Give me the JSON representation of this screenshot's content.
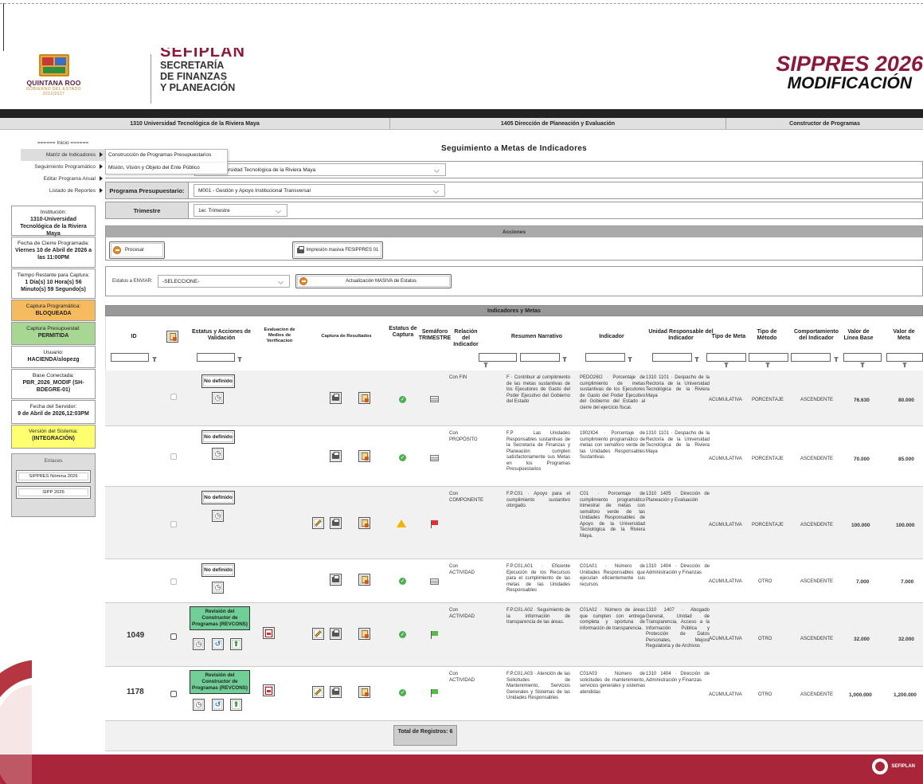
{
  "header": {
    "state_name": "QUINTANA ROO",
    "state_sub": "GOBIERNO DEL ESTADO 2022|2027",
    "sefiplan_big": "SEFIPLAN",
    "sefiplan_l1": "SECRETARÍA",
    "sefiplan_l2": "DE FINANZAS",
    "sefiplan_l3": "Y PLANEACIÓN",
    "app_title": "SIPPRES 2026",
    "app_subtitle": "MODIFICACIÓN"
  },
  "crumbs": [
    "1310 Universidad Tecnológica de la Riviera Maya",
    "1405 Dirección de Planeación y Evaluación",
    "Constructor de Programas"
  ],
  "menu": {
    "start": "====== Inicio ======",
    "items": [
      "Matriz de Indicadores",
      "Seguimiento Programático",
      "Editar Programa Anual",
      "Listado de Reportes"
    ],
    "submenu": [
      "Construcción de Programas Presupuestarios",
      "Misión, Visión y Objeto del Ente Público"
    ]
  },
  "sidebar": {
    "institucion_label": "Institución:",
    "institucion_value": "1310-Universidad Tecnológica de la Riviera Maya",
    "cierre_label": "Fecha de Cierre Programada:",
    "cierre_value": "Viernes 10 de Abril de 2026 a las 11:00PM",
    "tiempo_label": "Tiempo Restante para Captura:",
    "tiempo_value": "1 Día(s) 10 Hora(s) 56 Minuto(s) 59 Segundo(s)",
    "prog_label": "Captura Programática:",
    "prog_value": "BLOQUEADA",
    "pres_label": "Captura Presupuestal:",
    "pres_value": "PERMITIDA",
    "user_label": "Usuario:",
    "user_value": "HACIENDA\\slopezg",
    "db_label": "Base Conectada:",
    "db_value": "PBR_2026_MODIF (SH-BDEGRE-01)",
    "server_label": "Fecha del Servidor:",
    "server_value": "9 de Abril de 2026,12:03PM",
    "version_label": "Versión del Sistema:",
    "version_value": "(INTEGRACIÓN)",
    "links_title": "Enlaces",
    "link1": "SIPPRES Nómina 2026",
    "link2": "SIPP 2026"
  },
  "main": {
    "title": "Seguimiento a Metas de Indicadores",
    "inst_select": "1310 - Universidad Tecnológica de la Riviera Maya",
    "programa_label": "Programa Presupuestario:",
    "programa_value": "M001 - Gestión y Apoyo Institucional Transversal",
    "trimestre_label": "Trimestre",
    "trimestre_value": "1er. Trimestre",
    "acciones": "Acciones",
    "procesar": "Procesar",
    "impresion": "Impresión masiva FESIPPRES 01",
    "estatus_label": "Estatus a ENVIAR:",
    "estatus_value": "-SELECCIONE-",
    "actualizacion": "Actualización MASIVA de Estatus",
    "tabla_titulo": "Indicadores y Metas"
  },
  "columns": {
    "id": "ID",
    "estatus": "Estatus y Acciones de Validación",
    "evaluacion": "Evaluacion de Medios de Verificacion",
    "captura": "Captura de Resultados",
    "estatus_captura": "Estatus de Captura",
    "semaforo": "Semáforo TRIMESTRE",
    "relacion": "Relación del Indicador",
    "resumen": "Resumen Narrativo",
    "indicador": "Indicador",
    "unidad": "Unidad Responsable del Indicador",
    "tipo_meta": "Tipo de Meta",
    "tipo_metodo": "Tipo de Método",
    "comportamiento": "Comportamiento del Indicador",
    "linea_base": "Valor de Línea Base",
    "meta": "Valor de Meta"
  },
  "rows": [
    {
      "id": "",
      "status": "No definido",
      "relacion": "Con FIN",
      "resumen": "F · Contribuir al cumplimiento de las metas sustantivas de los Ejecutores de Gasto del Poder Ejecutivo del Gobierno del Estado",
      "indicador": "PEDO26I2 · Porcentaje de cumplimiento de metas sustantivas de los Ejecutores de Gasto del Poder Ejecutivo del Gobierno del Estado al cierre del ejercicio fiscal.",
      "unidad": "1310 1101 · Despacho de la Rectoría de la Universidad Tecnológica de la Riviera Maya",
      "tipo_meta": "ACUMULATIVA",
      "metodo": "PORCENTAJE",
      "comportamiento": "ASCENDENTE",
      "base": "76.630",
      "meta": "80.000"
    },
    {
      "id": "",
      "status": "No definido",
      "relacion": "Con PROPÓSITO",
      "resumen": "F.P · Las Unidades Responsables sustantivas de la Secretaría de Finanzas y Planeación cumplen satisfactoriamente sus Metas en los Programas Presupuestarios",
      "indicador": "1902IO4 · Porcentaje de cumplimiento programático de metas con semáforo verde de las Unidades Responsables Sustantivas",
      "unidad": "1310 1101 · Despacho de la Rectoría de la Universidad Tecnológica de la Riviera Maya",
      "tipo_meta": "ACUMULATIVA",
      "metodo": "PORCENTAJE",
      "comportamiento": "ASCENDENTE",
      "base": "70.000",
      "meta": "85.000"
    },
    {
      "id": "",
      "status": "No definido",
      "relacion": "Con COMPONENTE",
      "resumen": "F.P.C01 · Apoyo para el cumplimiento sustantivo otorgado.",
      "indicador": "C01 · Porcentaje de cumplimiento programático trimestral de metas con semáforo verde de las Unidades Responsables de Apoyo de la Universidad Tecnológica de la Riviera Maya.",
      "unidad": "1310 1405 · Dirección de Planeación y Evaluación",
      "tipo_meta": "ACUMULATIVA",
      "metodo": "PORCENTAJE",
      "comportamiento": "ASCENDENTE",
      "base": "100.000",
      "meta": "100.000"
    },
    {
      "id": "",
      "status": "No definido",
      "relacion": "Con ACTIVIDAD",
      "resumen": "F.P.C01.A01 · Eficiente Ejecución de los Recursos para el cumplimiento de las metas de las Unidades Responsables",
      "indicador": "C01A01 · Número de Unidades Responsables que ejecutan eficientemente sus recursos",
      "unidad": "1310 1404 · Dirección de Administración y Finanzas",
      "tipo_meta": "ACUMULATIVA",
      "metodo": "OTRO",
      "comportamiento": "ASCENDENTE",
      "base": "7.000",
      "meta": "7.000"
    },
    {
      "id": "1049",
      "status": "Revisión del Constructor de Programas (REVCONS)",
      "relacion": "Con ACTIVIDAD",
      "resumen": "F.P.C01.A02 · Seguimiento de la información de transparencia de las áreas.",
      "indicador": "C01A02 · Número de áreas que cumplen con entrega completa y oportuna de información de transparencia.",
      "unidad": "1310 1407 · Abogado General, Unidad de Transparencia, Acceso a la Información Pública y Protección de Datos Personales, Mejora Regulatoria y de Archivos",
      "tipo_meta": "ACUMULATIVA",
      "metodo": "OTRO",
      "comportamiento": "ASCENDENTE",
      "base": "32.000",
      "meta": "32.000"
    },
    {
      "id": "1178",
      "status": "Revisión del Constructor de Programas (REVCONS)",
      "relacion": "Con ACTIVIDAD",
      "resumen": "F.P.C01.A03 · Atención de las Solicitudes de Mantenimiento, Servicios Generales y Sistemas de las Unidades Responsables",
      "indicador": "C01A03 · Número de solicitudes de mantenimiento, servicios generales y sistemas atendidas",
      "unidad": "1310 1404 · Dirección de Administración y Finanzas",
      "tipo_meta": "ACUMULATIVA",
      "metodo": "OTRO",
      "comportamiento": "ASCENDENTE",
      "base": "1,000.000",
      "meta": "1,200.000"
    }
  ],
  "total": "Total de Registros: 6",
  "footer_brand": "SEFIPLAN",
  "colors": {
    "brand": "#8b1a3a",
    "footer": "#a8253a",
    "blocked": "#f6ba5f",
    "allowed": "#a8d794",
    "version": "#ffff70"
  }
}
